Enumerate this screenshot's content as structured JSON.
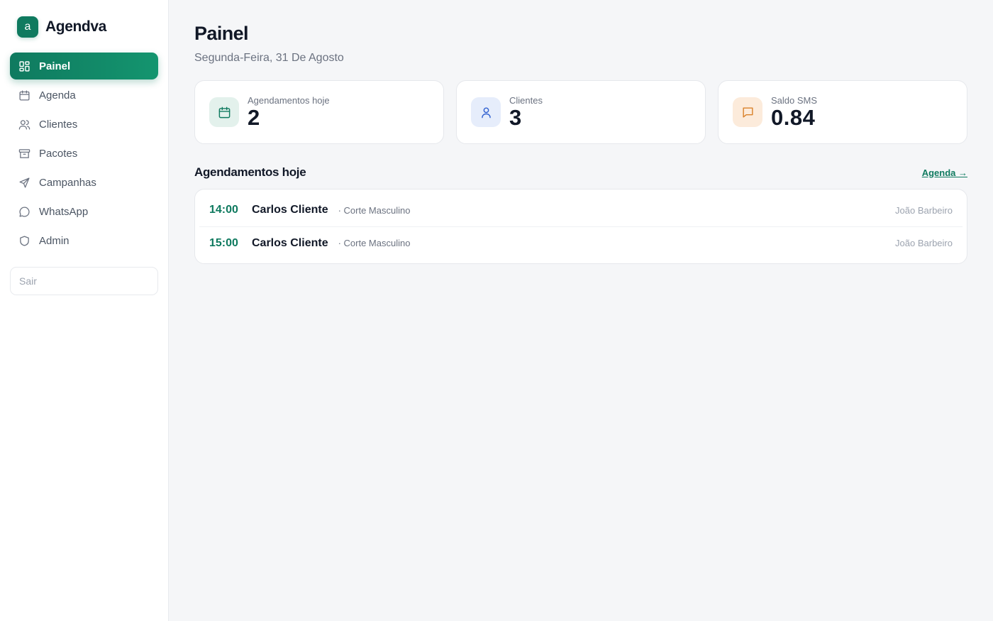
{
  "brand": {
    "logo_letter": "a",
    "name": "Agendva"
  },
  "sidebar": {
    "items": [
      {
        "label": "Painel",
        "icon": "dashboard-icon",
        "active": true
      },
      {
        "label": "Agenda",
        "icon": "calendar-icon",
        "active": false
      },
      {
        "label": "Clientes",
        "icon": "users-icon",
        "active": false
      },
      {
        "label": "Pacotes",
        "icon": "package-icon",
        "active": false
      },
      {
        "label": "Campanhas",
        "icon": "send-icon",
        "active": false
      },
      {
        "label": "WhatsApp",
        "icon": "chat-bubble-icon",
        "active": false
      },
      {
        "label": "Admin",
        "icon": "shield-icon",
        "active": false
      }
    ],
    "logout_label": "Sair"
  },
  "header": {
    "title": "Painel",
    "date": "Segunda-Feira, 31 De Agosto"
  },
  "stats": [
    {
      "label": "Agendamentos hoje",
      "value": "2",
      "icon": "calendar-icon",
      "color": "#0f7a5f",
      "bg": "#e3f1ec"
    },
    {
      "label": "Clientes",
      "value": "3",
      "icon": "user-icon",
      "color": "#2f5fd0",
      "bg": "#e6edfb"
    },
    {
      "label": "Saldo SMS",
      "value": "0.84",
      "icon": "message-icon",
      "color": "#d9822b",
      "bg": "#fcebdb"
    }
  ],
  "appointments_section": {
    "title": "Agendamentos hoje",
    "link_label": "Agenda →",
    "rows": [
      {
        "time": "14:00",
        "client": "Carlos Cliente",
        "service": "· Corte Masculino",
        "professional": "João Barbeiro"
      },
      {
        "time": "15:00",
        "client": "Carlos Cliente",
        "service": "· Corte Masculino",
        "professional": "João Barbeiro"
      }
    ]
  },
  "colors": {
    "accent": "#0f7a5f",
    "background": "#f5f6f8"
  }
}
